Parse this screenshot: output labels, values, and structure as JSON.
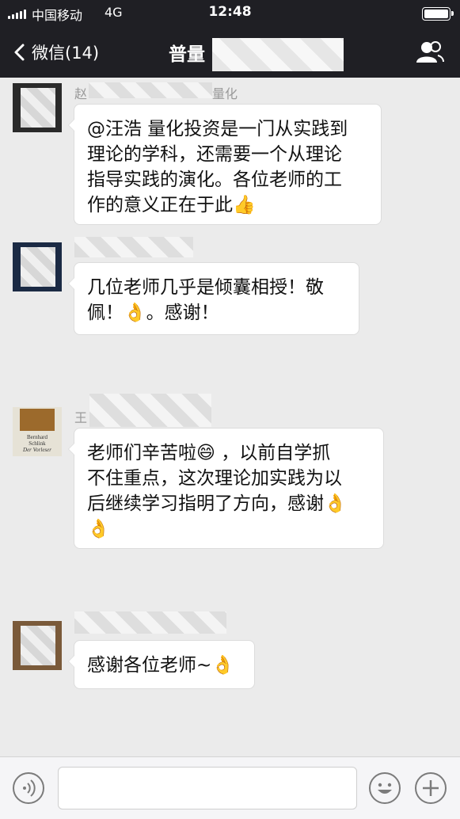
{
  "status_bar": {
    "carrier": "中国移动",
    "network": "4G",
    "time": "12:48"
  },
  "nav": {
    "back_label": "微信(14)",
    "title": "普量"
  },
  "messages": [
    {
      "sender_visible": "赵",
      "sender_visible_end": "量化",
      "lines": [
        "@汪浩 量化投资是一门从实践到",
        "理论的学科，还需要一个从理论",
        "指导实践的演化。各位老师的工",
        "作的意义正在于此👍"
      ]
    },
    {
      "sender_visible": "",
      "lines": [
        "几位老师几乎是倾囊相授！敬",
        "佩！👌。感谢！"
      ]
    },
    {
      "sender_visible": "王",
      "avatar_text": [
        "Bernhard",
        "Schlink",
        "Der Vorleser"
      ],
      "lines": [
        "老师们辛苦啦😄 ，以前自学抓",
        "不住重点，这次理论加实践为以",
        "后继续学习指明了方向，感谢👌",
        "👌"
      ]
    },
    {
      "sender_visible": "",
      "lines": [
        "感谢各位老师~👌"
      ]
    }
  ],
  "colors": {
    "header_bg": "#1f1f24",
    "chat_bg": "#ebebeb",
    "bubble_bg": "#ffffff"
  }
}
